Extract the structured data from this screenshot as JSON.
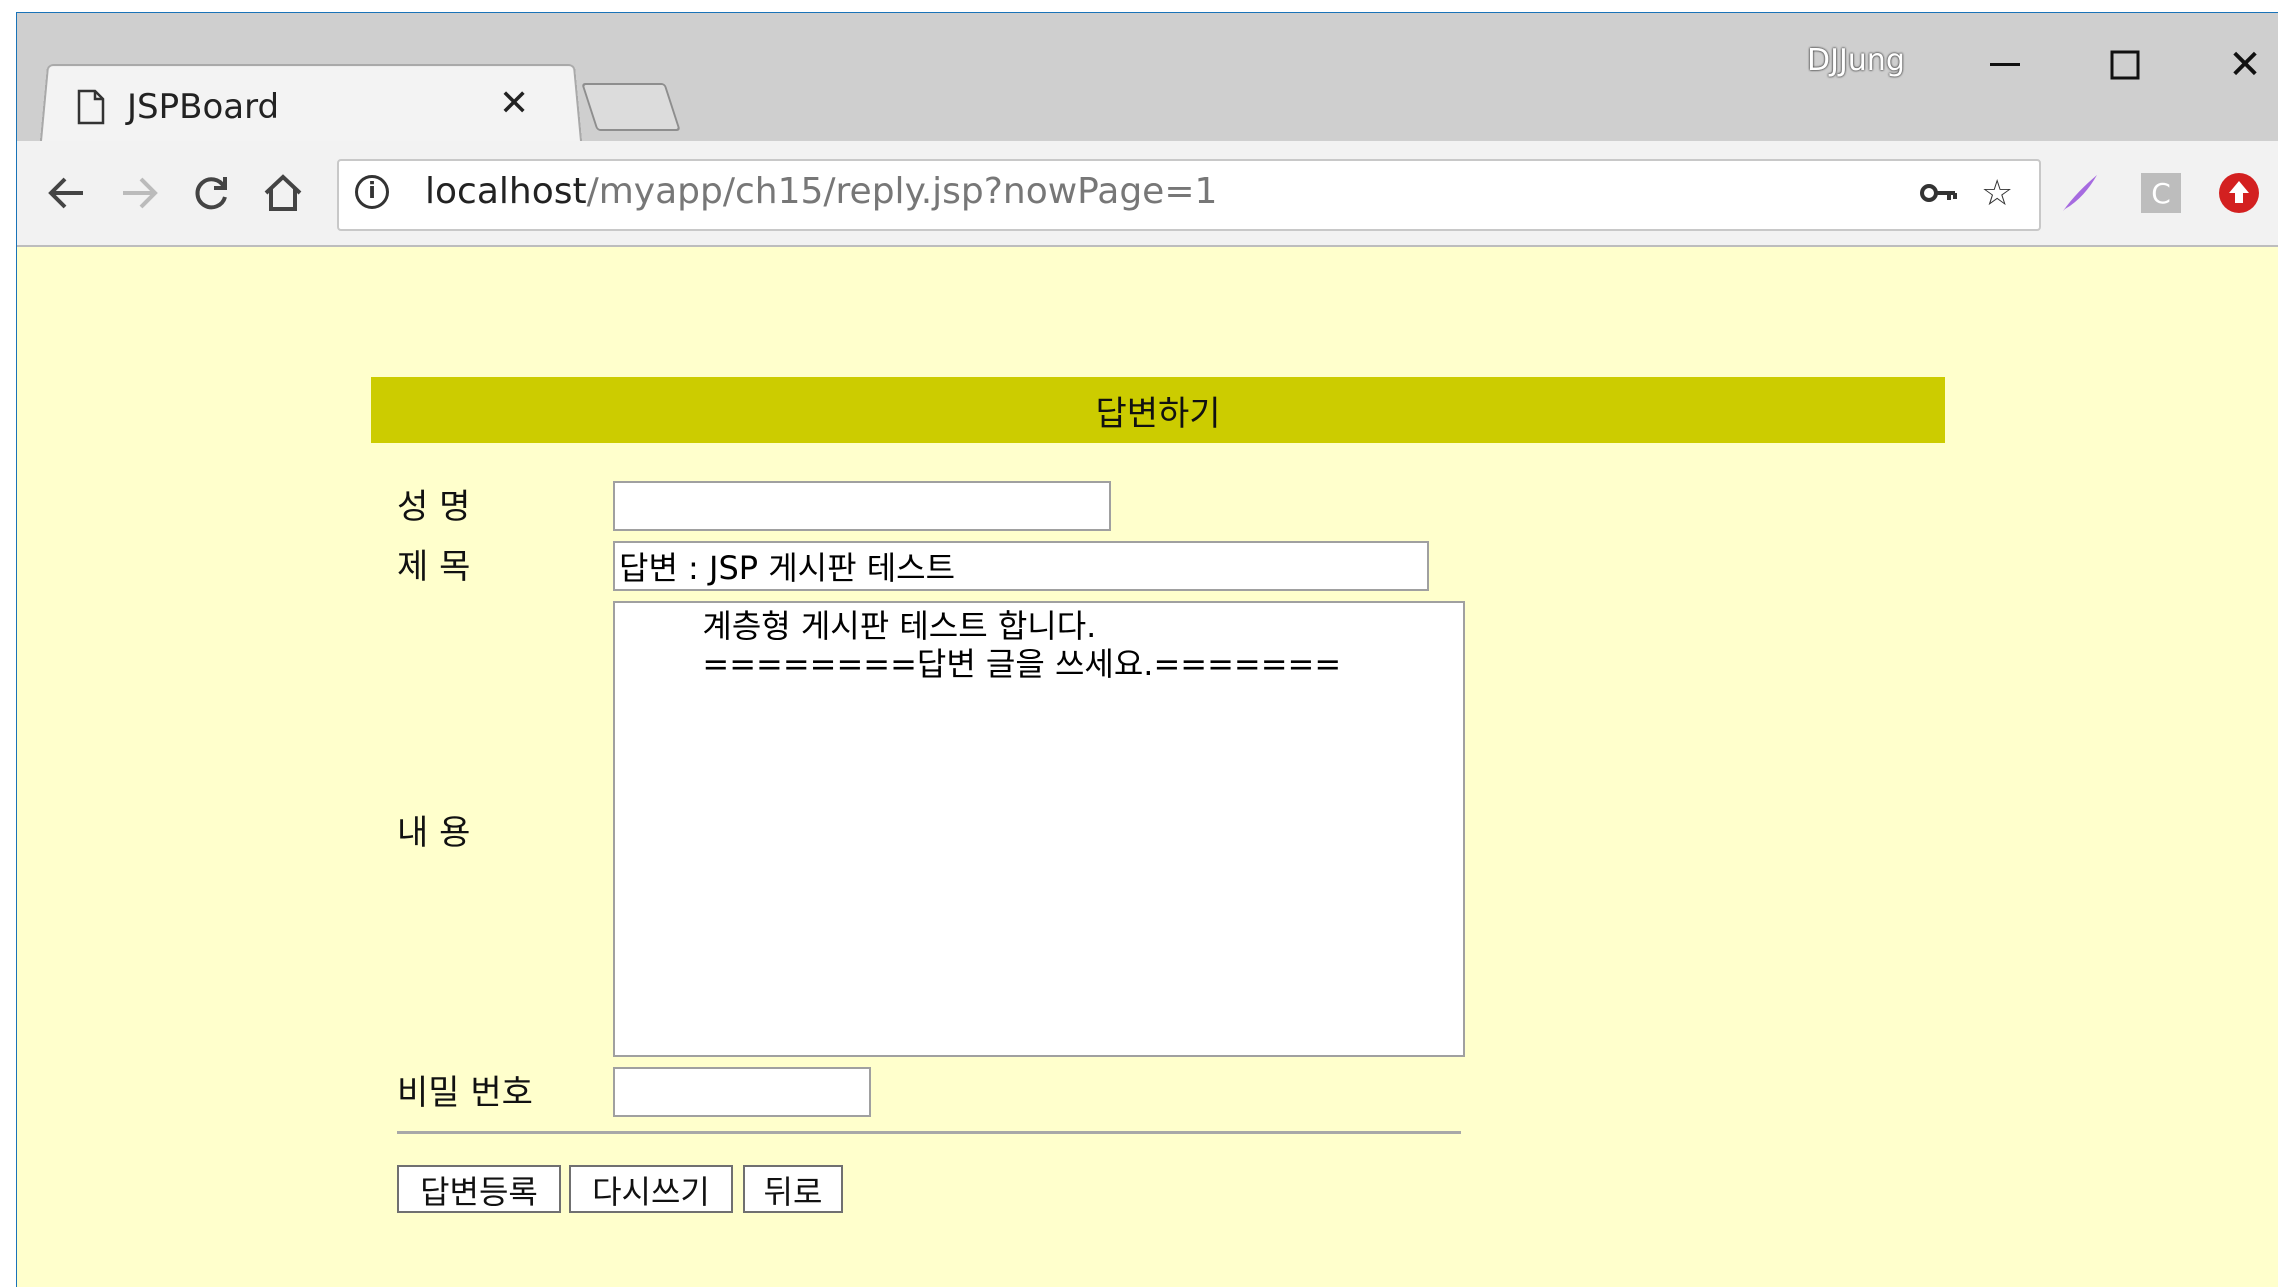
{
  "browser": {
    "tab_title": "JSPBoard",
    "profile_name": "DJJung",
    "url_host": "localhost",
    "url_path": "/myapp/ch15/reply.jsp?nowPage=1",
    "icons": {
      "page": "page-icon",
      "close": "close-icon",
      "back": "back-arrow-icon",
      "forward": "forward-arrow-icon",
      "reload": "reload-icon",
      "home": "home-icon",
      "info": "info-icon",
      "key": "key-icon",
      "star": "star-icon",
      "feather": "feather-icon",
      "c_ext": "c-extension-icon",
      "up": "upload-extension-icon"
    }
  },
  "page": {
    "header": "답변하기",
    "header_color": "#cccc00",
    "background_color": "#ffffcc",
    "labels": {
      "name": "성 명",
      "subject": "제 목",
      "content": "내 용",
      "password": "비밀 번호"
    },
    "values": {
      "name": "",
      "subject": "답변 : JSP 게시판 테스트",
      "content": "\t계층형 게시판 테스트 합니다.\n\t========답변 글을 쓰세요.=======",
      "password": ""
    },
    "buttons": {
      "submit": "답변등록",
      "reset": "다시쓰기",
      "back": "뒤로"
    }
  }
}
